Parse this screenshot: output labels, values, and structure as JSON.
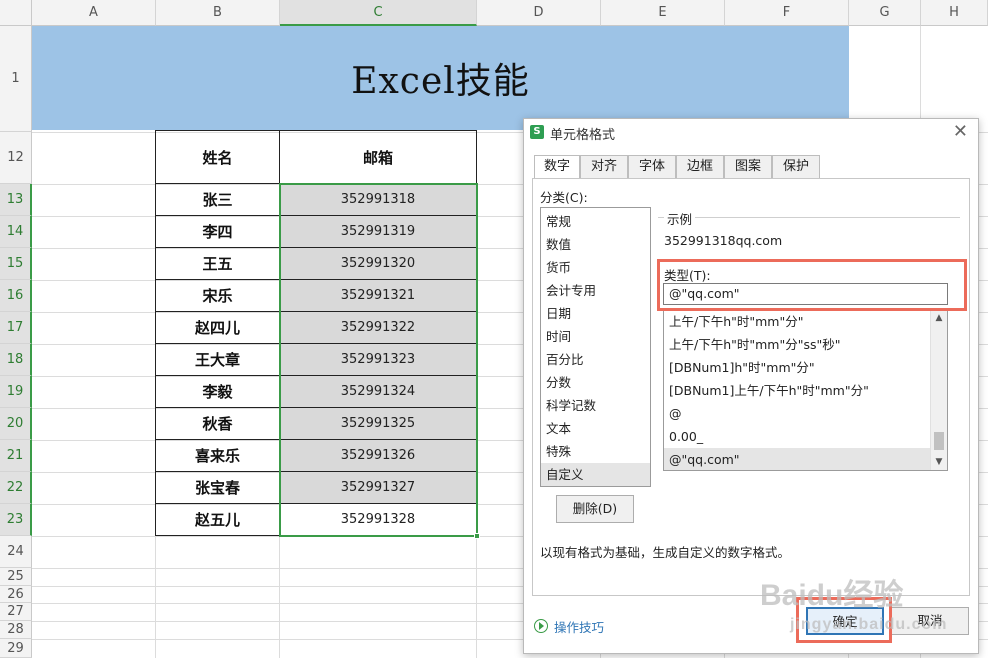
{
  "sheet": {
    "columns": [
      "A",
      "B",
      "C",
      "D",
      "E",
      "F",
      "G",
      "H"
    ],
    "rows": [
      "1",
      "12",
      "13",
      "14",
      "15",
      "16",
      "17",
      "18",
      "19",
      "20",
      "21",
      "22",
      "23",
      "24",
      "25",
      "26",
      "27",
      "28",
      "29"
    ],
    "title": "Excel技能",
    "table_header": {
      "name": "姓名",
      "email": "邮箱"
    },
    "records": [
      {
        "name": "张三",
        "email": "352991318"
      },
      {
        "name": "李四",
        "email": "352991319"
      },
      {
        "name": "王五",
        "email": "352991320"
      },
      {
        "name": "宋乐",
        "email": "352991321"
      },
      {
        "name": "赵四儿",
        "email": "352991322"
      },
      {
        "name": "王大章",
        "email": "352991323"
      },
      {
        "name": "李毅",
        "email": "352991324"
      },
      {
        "name": "秋香",
        "email": "352991325"
      },
      {
        "name": "喜来乐",
        "email": "352991326"
      },
      {
        "name": "张宝春",
        "email": "352991327"
      },
      {
        "name": "赵五儿",
        "email": "352991328"
      }
    ],
    "selected_column": "C",
    "accent_color": "#3a9b47",
    "title_band_color": "#9dc3e6"
  },
  "dialog": {
    "title": "单元格格式",
    "close_icon": "close-icon",
    "tabs": [
      "数字",
      "对齐",
      "字体",
      "边框",
      "图案",
      "保护"
    ],
    "active_tab": "数字",
    "category_label": "分类(C):",
    "categories": [
      "常规",
      "数值",
      "货币",
      "会计专用",
      "日期",
      "时间",
      "百分比",
      "分数",
      "科学记数",
      "文本",
      "特殊",
      "自定义"
    ],
    "selected_category": "自定义",
    "sample_label": "示例",
    "sample_value": "352991318qq.com",
    "type_label": "类型(T):",
    "type_value": "@\"qq.com\"",
    "format_list": [
      "上午/下午h\"时\"mm\"分\"",
      "上午/下午h\"时\"mm\"分\"ss\"秒\"",
      "[DBNum1]h\"时\"mm\"分\"",
      "[DBNum1]上午/下午h\"时\"mm\"分\"",
      "@",
      "0.00_",
      "@\"qq.com\""
    ],
    "selected_format": "@\"qq.com\"",
    "delete_button": "删除(D)",
    "description": "以现有格式为基础，生成自定义的数字格式。",
    "tips_link": "操作技巧",
    "ok_button": "确定",
    "cancel_button": "取消",
    "highlight_color": "#ec6b5a"
  },
  "watermark": {
    "brand": "Baidu经验",
    "url": "jingyan.baidu.com"
  }
}
